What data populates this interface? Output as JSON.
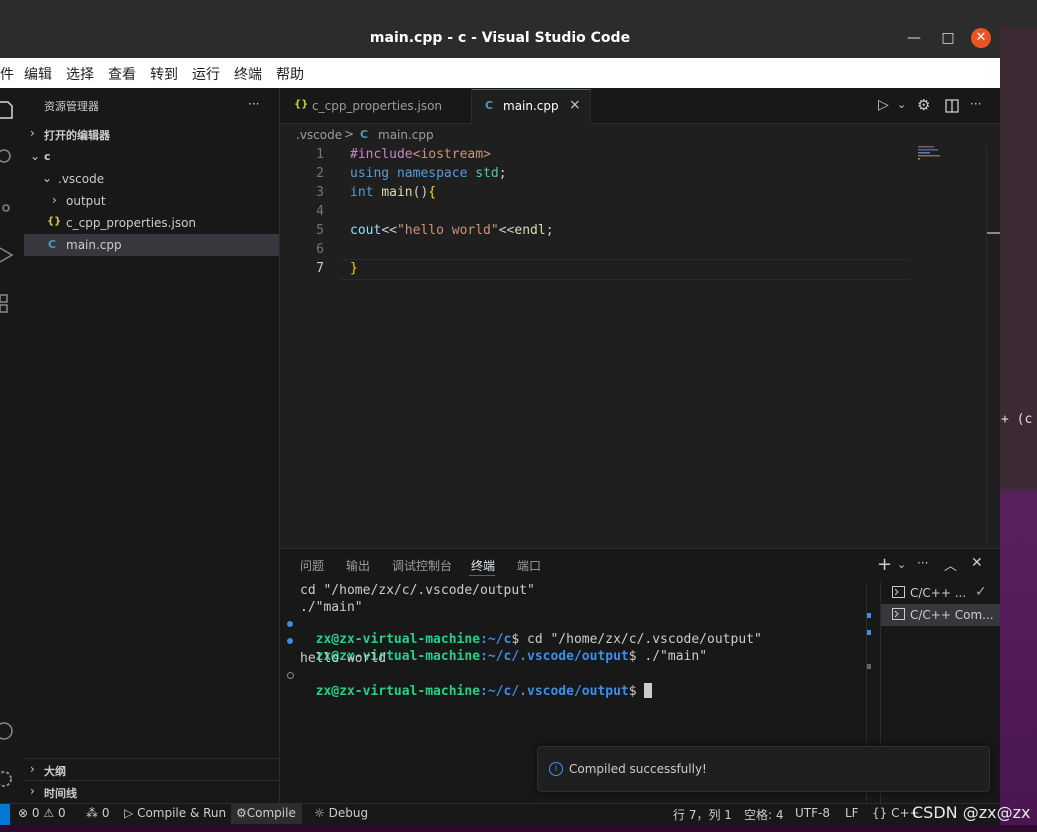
{
  "window": {
    "title": "main.cpp - c - Visual Studio Code"
  },
  "menubar": [
    "件",
    "编辑",
    "选择",
    "查看",
    "转到",
    "运行",
    "终端",
    "帮助"
  ],
  "sidebar": {
    "title": "资源管理器",
    "more": "···",
    "open_editors": "打开的编辑器",
    "root": "c",
    "tree": [
      {
        "label": ".vscode"
      },
      {
        "label": "output"
      },
      {
        "label": "c_cpp_properties.json",
        "icon": "{}"
      },
      {
        "label": "main.cpp",
        "icon": "C"
      }
    ],
    "outline": "大纲",
    "timeline": "时间线"
  },
  "tabs": [
    {
      "label": "c_cpp_properties.json",
      "icon": "{}"
    },
    {
      "label": "main.cpp",
      "icon": "C",
      "close": "×"
    }
  ],
  "breadcrumb": {
    "folder": ".vscode",
    "sep": ">",
    "file": "main.cpp"
  },
  "editor": {
    "line_numbers": [
      "1",
      "2",
      "3",
      "4",
      "5",
      "6",
      "7"
    ],
    "lines": [
      {
        "parts": [
          {
            "t": "#include",
            "c": "#c586c0"
          },
          {
            "t": "<iostream>",
            "c": "#ce9178"
          }
        ]
      },
      {
        "parts": [
          {
            "t": "using ",
            "c": "#569cd6"
          },
          {
            "t": "namespace ",
            "c": "#569cd6"
          },
          {
            "t": "std",
            "c": "#4ec9b0"
          },
          {
            "t": ";",
            "c": "#cccccc"
          }
        ]
      },
      {
        "parts": [
          {
            "t": "int ",
            "c": "#569cd6"
          },
          {
            "t": "main",
            "c": "#dcdcaa"
          },
          {
            "t": "()",
            "c": "#cccccc"
          },
          {
            "t": "{",
            "c": "#ffd700"
          }
        ]
      },
      {
        "parts": []
      },
      {
        "parts": [
          {
            "t": "cout",
            "c": "#9cdcfe"
          },
          {
            "t": "<<",
            "c": "#cccccc"
          },
          {
            "t": "\"hello world\"",
            "c": "#ce9178"
          },
          {
            "t": "<<",
            "c": "#cccccc"
          },
          {
            "t": "endl",
            "c": "#dcdcaa"
          },
          {
            "t": ";",
            "c": "#cccccc"
          }
        ]
      },
      {
        "parts": []
      },
      {
        "parts": [
          {
            "t": "}",
            "c": "#ffd700"
          }
        ]
      }
    ]
  },
  "panel": {
    "tabs": [
      "问题",
      "输出",
      "调试控制台",
      "终端",
      "端口"
    ],
    "active_tab": "终端",
    "terminal": {
      "line1": "cd \"/home/zx/c/.vscode/output\"",
      "line2": "./\"main\"",
      "line3": {
        "user": "zx@zx-virtual-machine",
        "path": ":~/c",
        "cmd": "$ cd \"/home/zx/c/.vscode/output\""
      },
      "line4": {
        "user": "zx@zx-virtual-machine",
        "path": ":~/c/.vscode/output",
        "cmd": "$ ./\"main\""
      },
      "line5": "hello world",
      "line6": {
        "user": "zx@zx-virtual-machine",
        "path": ":~/c/.vscode/output",
        "cmd": "$ "
      }
    },
    "terminal_list": [
      "C/C++ ...",
      "C/C++ Com..."
    ]
  },
  "notification": {
    "text": "Compiled successfully!"
  },
  "statusbar": {
    "errors": "0",
    "warnings": "0",
    "ports": "0",
    "compile_run": "Compile & Run",
    "compile": "Compile",
    "debug": "Debug",
    "position": "行 7，列 1",
    "spaces": "空格: 4",
    "encoding": "UTF-8",
    "eol": "LF",
    "language": "{} C++",
    "watermark": "CSDN @zx@zx"
  },
  "desktop": {
    "right_text": "+ (c"
  },
  "colors": {
    "accent": "#0078d4",
    "close": "#e95420",
    "prompt_user": "#23d18b",
    "prompt_path": "#3b8eea"
  }
}
